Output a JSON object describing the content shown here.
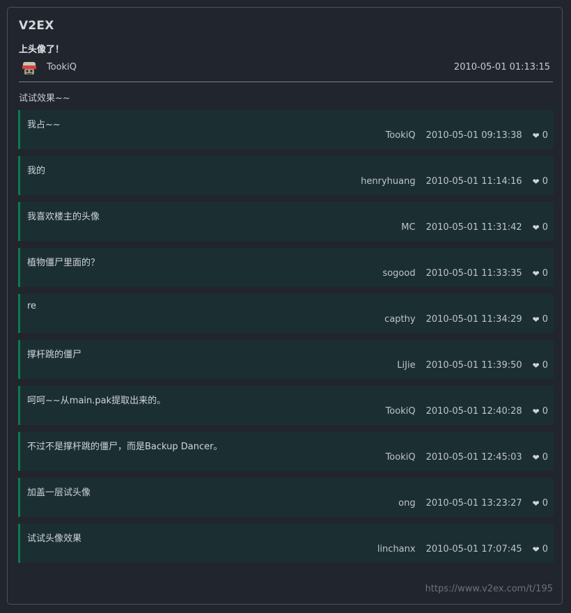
{
  "site": {
    "title": "V2EX"
  },
  "topic": {
    "title": "上头像了！",
    "author": "TookiQ",
    "time": "2010-05-01 01:13:15",
    "content": "试试效果~~"
  },
  "replies": [
    {
      "text": "我占~~",
      "user": "TookiQ",
      "time": "2010-05-01 09:13:38",
      "likes": "0"
    },
    {
      "text": "我的",
      "user": "henryhuang",
      "time": "2010-05-01 11:14:16",
      "likes": "0"
    },
    {
      "text": "我喜欢楼主的头像",
      "user": "MC",
      "time": "2010-05-01 11:31:42",
      "likes": "0"
    },
    {
      "text": "植物僵尸里面的？",
      "user": "sogood",
      "time": "2010-05-01 11:33:35",
      "likes": "0"
    },
    {
      "text": "re",
      "user": "capthy",
      "time": "2010-05-01 11:34:29",
      "likes": "0"
    },
    {
      "text": "撑杆跳的僵尸",
      "user": "LiJie",
      "time": "2010-05-01 11:39:50",
      "likes": "0"
    },
    {
      "text": "呵呵~~从main.pak提取出来的。",
      "user": "TookiQ",
      "time": "2010-05-01 12:40:28",
      "likes": "0"
    },
    {
      "text": "不过不是撑杆跳的僵尸，而是Backup Dancer。",
      "user": "TookiQ",
      "time": "2010-05-01 12:45:03",
      "likes": "0"
    },
    {
      "text": "加盖一层试头像",
      "user": "ong",
      "time": "2010-05-01 13:23:27",
      "likes": "0"
    },
    {
      "text": "试试头像效果",
      "user": "linchanx",
      "time": "2010-05-01 17:07:45",
      "likes": "0"
    }
  ],
  "footer": {
    "url": "https://www.v2ex.com/t/195"
  },
  "icons": {
    "heart": "heart-icon",
    "avatar": "zombie-avatar"
  },
  "colors": {
    "accent": "#0d7a4e",
    "reply_bg": "#1b2f33",
    "page_bg": "#21262e"
  }
}
